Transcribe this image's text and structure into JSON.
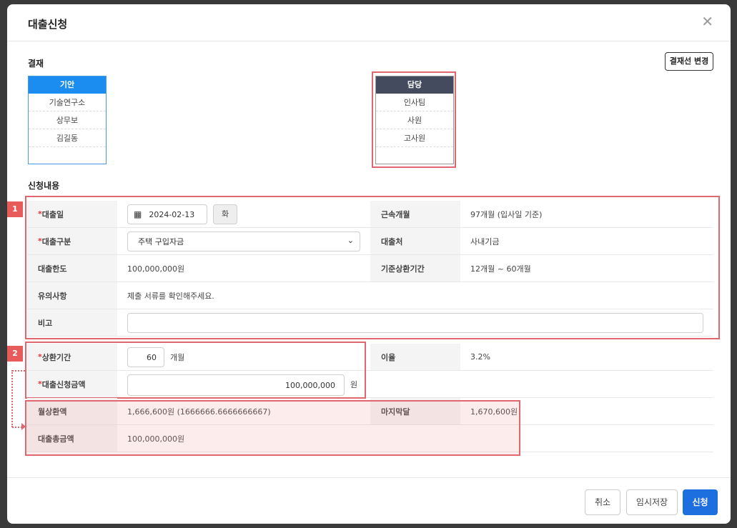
{
  "modal": {
    "title": "대출신청"
  },
  "approval": {
    "section_label": "결재",
    "change_button": "결재선 변경",
    "draft": {
      "header": "기안",
      "rows": [
        "기술연구소",
        "상무보",
        "김길동"
      ],
      "color": "#1b8cf0"
    },
    "charge": {
      "header": "담당",
      "rows": [
        "인사팀",
        "사원",
        "고사원"
      ],
      "color": "#454b5e"
    }
  },
  "content": {
    "section_label": "신청내용",
    "badge1": "1",
    "badge2": "2",
    "loan_date": {
      "label": "대출일",
      "value": "2024-02-13",
      "day": "화"
    },
    "tenure": {
      "label": "근속개월",
      "value": "97개월 (입사일 기준)"
    },
    "loan_type": {
      "label": "대출구분",
      "value": "주택 구입자금"
    },
    "lender": {
      "label": "대출처",
      "value": "사내기금"
    },
    "limit": {
      "label": "대출한도",
      "value": "100,000,000원"
    },
    "standard_period": {
      "label": "기준상환기간",
      "value": "12개월 ~ 60개월"
    },
    "notice": {
      "label": "유의사항",
      "value": "제출 서류를 확인해주세요."
    },
    "remarks": {
      "label": "비고",
      "value": ""
    },
    "repay_period": {
      "label": "상환기간",
      "value": "60",
      "unit": "개월"
    },
    "interest": {
      "label": "이율",
      "value": "3.2%"
    },
    "amount": {
      "label": "대출신청금액",
      "value": "100,000,000",
      "unit": "원"
    },
    "monthly": {
      "label": "월상환액",
      "value": "1,666,600원 (1666666.6666666667)"
    },
    "last_payment": {
      "label": "마지막달",
      "value": "1,670,600원"
    },
    "total": {
      "label": "대출총금액",
      "value": "100,000,000원"
    },
    "required_mark": "*"
  },
  "footer": {
    "cancel": "취소",
    "save_draft": "임시저장",
    "submit": "신청"
  }
}
